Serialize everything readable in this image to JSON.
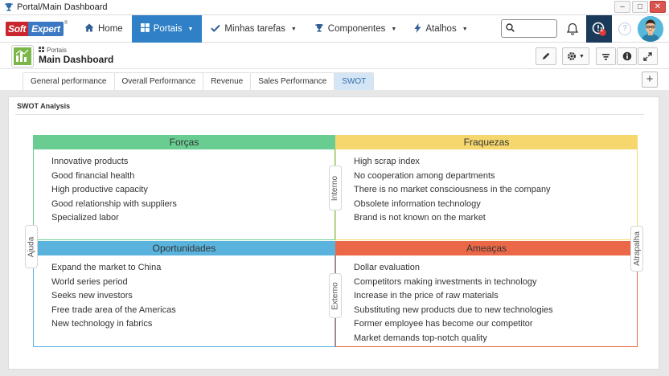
{
  "window": {
    "title": "Portal/Main Dashboard",
    "buttons": {
      "minimize": "–",
      "maximize": "□",
      "close": "✕"
    }
  },
  "logo": {
    "part1": "Soft",
    "part2": "Expert",
    "reg": "®"
  },
  "nav": {
    "items": [
      {
        "label": "Home",
        "icon": "home-icon"
      },
      {
        "label": "Portais",
        "icon": "grid-icon",
        "active": true,
        "dropdown": true
      },
      {
        "label": "Minhas tarefas",
        "icon": "check-icon",
        "dropdown": true
      },
      {
        "label": "Componentes",
        "icon": "trophy-icon",
        "dropdown": true
      },
      {
        "label": "Atalhos",
        "icon": "bolt-icon",
        "dropdown": true
      }
    ],
    "alert_count": "1"
  },
  "page": {
    "breadcrumb": "Portais",
    "title": "Main Dashboard"
  },
  "tabs": [
    {
      "label": "General performance"
    },
    {
      "label": "Overall Performance"
    },
    {
      "label": "Revenue"
    },
    {
      "label": "Sales Performance"
    },
    {
      "label": "SWOT",
      "active": true
    }
  ],
  "panel": {
    "title": "SWOT Analysis"
  },
  "swot": {
    "side_labels": {
      "left": "Ajuda",
      "right": "Atrapalha",
      "top_middle": "Interno",
      "bottom_middle": "Externo"
    },
    "strengths": {
      "title": "Forças",
      "color": "#69cd91",
      "items": [
        "Innovative products",
        "Good financial health",
        "High productive capacity",
        "Good relationship with suppliers",
        "Specialized labor"
      ]
    },
    "weaknesses": {
      "title": "Fraquezas",
      "color": "#f5d76e",
      "items": [
        "High scrap index",
        "No cooperation among departments",
        "There is no market consciousness in the company",
        "Obsolete information technology",
        "Brand is not known on the market"
      ]
    },
    "opportunities": {
      "title": "Oportunidades",
      "color": "#5ab3dd",
      "items": [
        "Expand the market to China",
        "World series period",
        "Seeks new investors",
        "Free trade area of the Americas",
        "New technology in fabrics"
      ]
    },
    "threats": {
      "title": "Ameaças",
      "color": "#ea6848",
      "items": [
        "Dollar evaluation",
        "Competitors making investments in technology",
        "Increase in the price of raw materials",
        "Substituting new products due to new technologies",
        "Former employee has become our competitor",
        "Market demands top-notch quality"
      ]
    }
  }
}
